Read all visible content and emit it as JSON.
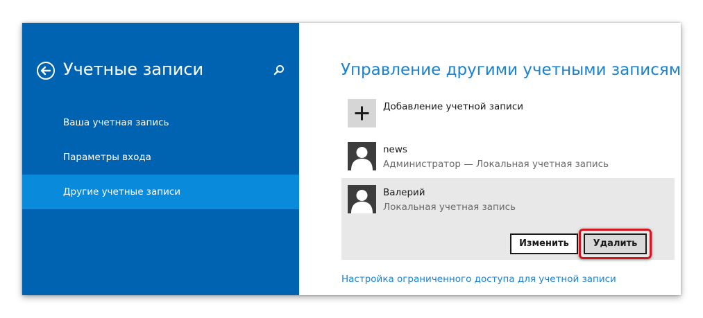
{
  "sidebar": {
    "title": "Учетные записи",
    "back_icon": "back-arrow-icon",
    "search_icon": "search-icon",
    "items": [
      {
        "label": "Ваша учетная запись",
        "active": false
      },
      {
        "label": "Параметры входа",
        "active": false
      },
      {
        "label": "Другие учетные записи",
        "active": true
      }
    ]
  },
  "main": {
    "title": "Управление другими учетными записями",
    "add_account": {
      "label": "Добавление учетной записи",
      "icon": "plus-icon"
    },
    "accounts": [
      {
        "name": "news",
        "description": "Администратор — Локальная учетная запись",
        "selected": false
      },
      {
        "name": "Валерий",
        "description": "Локальная учетная запись",
        "selected": true
      }
    ],
    "buttons": {
      "change_label": "Изменить",
      "delete_label": "Удалить"
    },
    "restricted_access_link": "Настройка ограниченного доступа для учетной записи"
  },
  "colors": {
    "sidebar_bg": "#0063b1",
    "sidebar_active": "#0a8adb",
    "accent_text": "#1b82d1",
    "highlight": "#d2161e"
  }
}
